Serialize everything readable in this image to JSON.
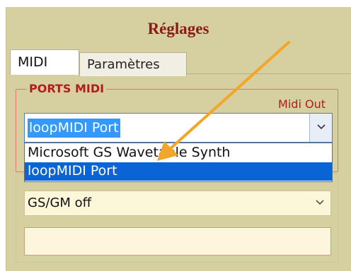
{
  "dialog": {
    "title": "Réglages"
  },
  "tabs": [
    {
      "label": "MIDI",
      "active": true
    },
    {
      "label": "Paramètres",
      "active": false
    }
  ],
  "ports_group": {
    "label": "PORTS MIDI",
    "midi_out_label": "Midi Out",
    "midi_out_value": "loopMIDI Port",
    "dropdown_options": [
      {
        "label": "Microsoft GS Wavetable Synth",
        "highlighted": false
      },
      {
        "label": "loopMIDI Port",
        "highlighted": true
      }
    ]
  },
  "gs_mode": {
    "value": "GS/GM off"
  },
  "text_field": {
    "value": ""
  },
  "icons": {
    "dropdown_arrow": "chevron-down-icon",
    "annotation_arrow": "orange-arrow-annotation"
  },
  "colors": {
    "panel_bg": "#d6cfa0",
    "title": "#8b1a1a",
    "group_label": "#b21c1c",
    "selection": "#0a64d6",
    "text_selection": "#3399ff",
    "annotation_arrow": "#f4a62a"
  }
}
